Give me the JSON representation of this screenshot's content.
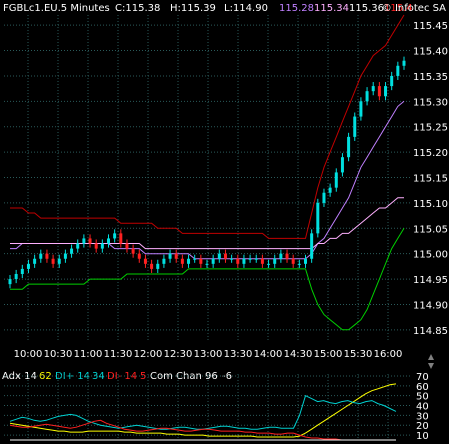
{
  "header": {
    "symbol_line": "FGBLc1.EU.5 Minutes",
    "close": "C:115.38",
    "high": "H:115.39",
    "low": "L:114.90",
    "ma1": "115.28",
    "ma2": "115.34",
    "ma3": "115.36",
    "ma4": "115.4",
    "vendor": "© Infotec SA"
  },
  "indicator_header": {
    "adx": "Adx 14",
    "adx_val": "62",
    "diplus": "DI+ 14",
    "diplus_val": "34",
    "diminus": "DI- 14",
    "diminus_val": "5",
    "comchan": "Com Chan 96",
    "comchan_val": "-6"
  },
  "colors": {
    "background": "#000000",
    "up_candle": "#00e0e0",
    "down_candle": "#ff2020",
    "bb_upper": "#c00000",
    "bb_lower": "#00d000",
    "ma_mid": "#c080ff",
    "ma_slow": "#ffb0ff",
    "adx": "#ffff00",
    "diplus": "#00d0d0",
    "diminus": "#ff2020",
    "comchan": "#ffffff",
    "grid": "#2a5a5a"
  },
  "chart_data": [
    {
      "type": "candlestick",
      "title": "FGBLc1.EU.5 Minutes",
      "x_ticks": [
        "10:00",
        "10:30",
        "11:00",
        "11:30",
        "12:00",
        "12:30",
        "13:00",
        "13:30",
        "14:00",
        "14:30",
        "15:00",
        "15:30",
        "16:00"
      ],
      "y_ticks": [
        "115.45",
        "115.40",
        "115.35",
        "115.30",
        "115.25",
        "115.20",
        "115.15",
        "115.10",
        "115.05",
        "115.00",
        "114.95",
        "114.90",
        "114.85"
      ],
      "ylim": [
        114.83,
        115.47
      ],
      "grid": true,
      "series": [
        {
          "name": "price",
          "close": [
            114.95,
            114.96,
            114.97,
            114.98,
            114.99,
            115.0,
            114.99,
            114.98,
            114.99,
            115.0,
            115.01,
            115.02,
            115.03,
            115.02,
            115.01,
            115.02,
            115.03,
            115.04,
            115.02,
            115.01,
            115.0,
            114.99,
            114.98,
            114.97,
            114.98,
            114.99,
            115.0,
            114.99,
            114.98,
            114.99,
            114.99,
            114.98,
            114.98,
            114.99,
            115.0,
            114.99,
            114.99,
            114.98,
            114.99,
            114.99,
            114.99,
            114.98,
            114.98,
            114.99,
            115.0,
            114.99,
            114.98,
            114.98,
            114.99,
            115.04,
            115.1,
            115.12,
            115.13,
            115.16,
            115.19,
            115.23,
            115.27,
            115.3,
            115.32,
            115.33,
            115.31,
            115.33,
            115.35,
            115.37,
            115.38
          ]
        },
        {
          "name": "bb_upper",
          "values": [
            115.09,
            115.09,
            115.09,
            115.08,
            115.08,
            115.07,
            115.07,
            115.07,
            115.07,
            115.07,
            115.07,
            115.07,
            115.07,
            115.07,
            115.07,
            115.07,
            115.07,
            115.07,
            115.06,
            115.06,
            115.06,
            115.06,
            115.06,
            115.06,
            115.05,
            115.05,
            115.05,
            115.05,
            115.04,
            115.04,
            115.04,
            115.04,
            115.04,
            115.04,
            115.04,
            115.04,
            115.04,
            115.04,
            115.04,
            115.04,
            115.04,
            115.04,
            115.03,
            115.03,
            115.03,
            115.03,
            115.03,
            115.03,
            115.03,
            115.08,
            115.13,
            115.17,
            115.2,
            115.23,
            115.26,
            115.29,
            115.32,
            115.35,
            115.37,
            115.39,
            115.4,
            115.41,
            115.43,
            115.45,
            115.47
          ]
        },
        {
          "name": "bb_lower",
          "values": [
            114.93,
            114.93,
            114.93,
            114.94,
            114.94,
            114.94,
            114.94,
            114.94,
            114.94,
            114.94,
            114.94,
            114.94,
            114.94,
            114.95,
            114.95,
            114.95,
            114.95,
            114.95,
            114.95,
            114.96,
            114.96,
            114.96,
            114.96,
            114.96,
            114.96,
            114.96,
            114.96,
            114.96,
            114.96,
            114.97,
            114.97,
            114.97,
            114.97,
            114.97,
            114.97,
            114.97,
            114.97,
            114.97,
            114.97,
            114.97,
            114.97,
            114.97,
            114.97,
            114.97,
            114.97,
            114.97,
            114.97,
            114.97,
            114.97,
            114.93,
            114.9,
            114.88,
            114.87,
            114.86,
            114.85,
            114.85,
            114.86,
            114.87,
            114.89,
            114.92,
            114.95,
            114.98,
            115.01,
            115.03,
            115.05
          ]
        },
        {
          "name": "ma_mid",
          "values": [
            115.01,
            115.01,
            115.02,
            115.02,
            115.02,
            115.02,
            115.02,
            115.02,
            115.02,
            115.02,
            115.02,
            115.02,
            115.02,
            115.02,
            115.02,
            115.02,
            115.02,
            115.01,
            115.01,
            115.01,
            115.01,
            115.01,
            115.0,
            115.0,
            115.0,
            115.0,
            115.0,
            115.0,
            115.0,
            115.0,
            114.99,
            114.99,
            114.99,
            114.99,
            114.99,
            114.99,
            114.99,
            114.99,
            114.99,
            114.99,
            114.99,
            114.99,
            114.99,
            114.99,
            114.99,
            114.99,
            114.99,
            114.99,
            114.99,
            115.0,
            115.02,
            115.03,
            115.05,
            115.07,
            115.09,
            115.11,
            115.14,
            115.17,
            115.19,
            115.21,
            115.23,
            115.25,
            115.27,
            115.29,
            115.3
          ]
        },
        {
          "name": "ma_slow",
          "values": [
            115.02,
            115.02,
            115.02,
            115.02,
            115.02,
            115.02,
            115.02,
            115.02,
            115.02,
            115.02,
            115.02,
            115.02,
            115.02,
            115.02,
            115.02,
            115.02,
            115.02,
            115.02,
            115.02,
            115.02,
            115.02,
            115.02,
            115.01,
            115.01,
            115.01,
            115.01,
            115.01,
            115.01,
            115.01,
            115.01,
            115.01,
            115.01,
            115.01,
            115.01,
            115.01,
            115.01,
            115.01,
            115.01,
            115.01,
            115.01,
            115.01,
            115.01,
            115.01,
            115.01,
            115.01,
            115.01,
            115.01,
            115.01,
            115.01,
            115.01,
            115.02,
            115.02,
            115.03,
            115.03,
            115.04,
            115.04,
            115.05,
            115.06,
            115.07,
            115.08,
            115.09,
            115.09,
            115.1,
            115.11,
            115.11
          ]
        }
      ]
    },
    {
      "type": "line",
      "title": "Adx 14 / DI 14 / Com Chan 96",
      "y_ticks": [
        "70",
        "60",
        "50",
        "40",
        "30",
        "20",
        "10"
      ],
      "ylim": [
        5,
        72
      ],
      "series": [
        {
          "name": "Adx 14",
          "values": [
            22,
            21,
            20,
            19,
            18,
            17,
            16,
            15,
            14,
            14,
            13,
            13,
            13,
            14,
            14,
            14,
            14,
            14,
            14,
            13,
            13,
            12,
            12,
            12,
            12,
            12,
            11,
            11,
            11,
            10,
            10,
            10,
            10,
            9,
            9,
            9,
            9,
            9,
            9,
            9,
            9,
            8,
            8,
            8,
            8,
            8,
            8,
            8,
            9,
            12,
            16,
            20,
            24,
            28,
            32,
            36,
            40,
            44,
            48,
            52,
            55,
            57,
            59,
            61,
            62
          ]
        },
        {
          "name": "DI+ 14",
          "values": [
            24,
            26,
            28,
            27,
            25,
            24,
            25,
            27,
            29,
            30,
            31,
            30,
            27,
            24,
            22,
            20,
            19,
            18,
            17,
            18,
            19,
            20,
            19,
            18,
            17,
            16,
            16,
            17,
            18,
            18,
            17,
            16,
            16,
            17,
            18,
            19,
            19,
            18,
            17,
            17,
            16,
            16,
            17,
            18,
            18,
            17,
            17,
            17,
            30,
            50,
            47,
            44,
            45,
            43,
            42,
            44,
            45,
            43,
            42,
            44,
            45,
            42,
            40,
            37,
            34
          ]
        },
        {
          "name": "DI- 14",
          "values": [
            20,
            19,
            18,
            18,
            19,
            20,
            21,
            20,
            19,
            18,
            17,
            18,
            20,
            22,
            24,
            25,
            22,
            20,
            18,
            16,
            15,
            14,
            14,
            15,
            16,
            17,
            17,
            16,
            15,
            14,
            14,
            15,
            16,
            16,
            15,
            14,
            14,
            14,
            14,
            13,
            13,
            12,
            12,
            12,
            11,
            11,
            12,
            12,
            10,
            8,
            7,
            7,
            6,
            6,
            6,
            5,
            5,
            5,
            5,
            5,
            5,
            5,
            5,
            5,
            5
          ]
        },
        {
          "name": "Com Chan 96",
          "values": [
            5,
            5,
            5,
            5,
            5,
            5,
            5,
            5,
            5,
            5,
            5,
            5,
            5,
            5,
            5,
            5,
            5,
            5,
            5,
            5,
            5,
            5,
            5,
            5,
            5,
            5,
            5,
            5,
            5,
            5,
            5,
            5,
            5,
            5,
            5,
            5,
            5,
            5,
            5,
            5,
            5,
            5,
            5,
            5,
            5,
            5,
            5,
            5,
            5,
            5,
            5,
            5,
            5,
            5,
            5,
            5,
            5,
            5,
            5,
            5,
            5,
            5,
            5,
            5,
            5
          ]
        }
      ]
    }
  ]
}
